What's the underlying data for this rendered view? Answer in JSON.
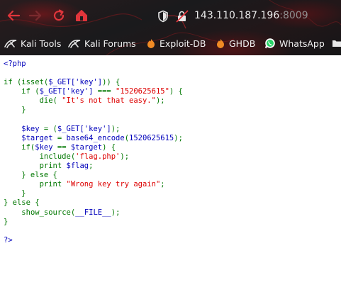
{
  "browser": {
    "url_host": "143.110.187.196",
    "url_port": ":8009",
    "nav": {
      "back_icon": "back-arrow-icon",
      "forward_icon": "forward-arrow-icon",
      "reload_icon": "reload-icon",
      "home_icon": "home-icon"
    },
    "bookmarks": [
      {
        "label": "Kali Tools",
        "icon": "kali-dragon-icon"
      },
      {
        "label": "Kali Forums",
        "icon": "kali-dragon-icon"
      },
      {
        "label": "Exploit-DB",
        "icon": "exploit-db-icon"
      },
      {
        "label": "GHDB",
        "icon": "ghdb-icon"
      },
      {
        "label": "WhatsApp",
        "icon": "whatsapp-icon"
      }
    ],
    "accent_color": "#e0353b"
  },
  "source": {
    "open_tag": "<?php",
    "lines": {
      "l1_a": "if (isset(",
      "l1_b": "$_GET['key']",
      "l1_c": ")) {",
      "l2_a": "    if (",
      "l2_b": "$_GET['key']",
      "l2_c": " === ",
      "l2_d": "\"1520625615\"",
      "l2_e": ") {",
      "l3_a": "        die(",
      "l3_b": " \"It's not that easy.\"",
      "l3_c": ");",
      "l4": "    }",
      "l5_a": "    $key",
      "l5_b": " = (",
      "l5_c": "$_GET['key']",
      "l5_d": ");",
      "l6_a": "    $target",
      "l6_b": " = ",
      "l6_c": "base64_encode",
      "l6_d": "(",
      "l6_e": "1520625615",
      "l6_f": ");",
      "l7_a": "    if(",
      "l7_b": "$key",
      "l7_c": " == ",
      "l7_d": "$target",
      "l7_e": ") {",
      "l8_a": "        include(",
      "l8_b": "'flag.php'",
      "l8_c": ");",
      "l9_a": "        print ",
      "l9_b": "$flag",
      "l9_c": ";",
      "l10_a": "    } else {",
      "l11_a": "        print ",
      "l11_b": "\"Wrong key try again\"",
      "l11_c": ";",
      "l12": "    }",
      "l13": "} else {",
      "l14_a": "    ",
      "l14_b": "show_source",
      "l14_c": "(",
      "l14_d": "__FILE__",
      "l14_e": ");",
      "l15": "}"
    },
    "close_tag": "?>"
  }
}
